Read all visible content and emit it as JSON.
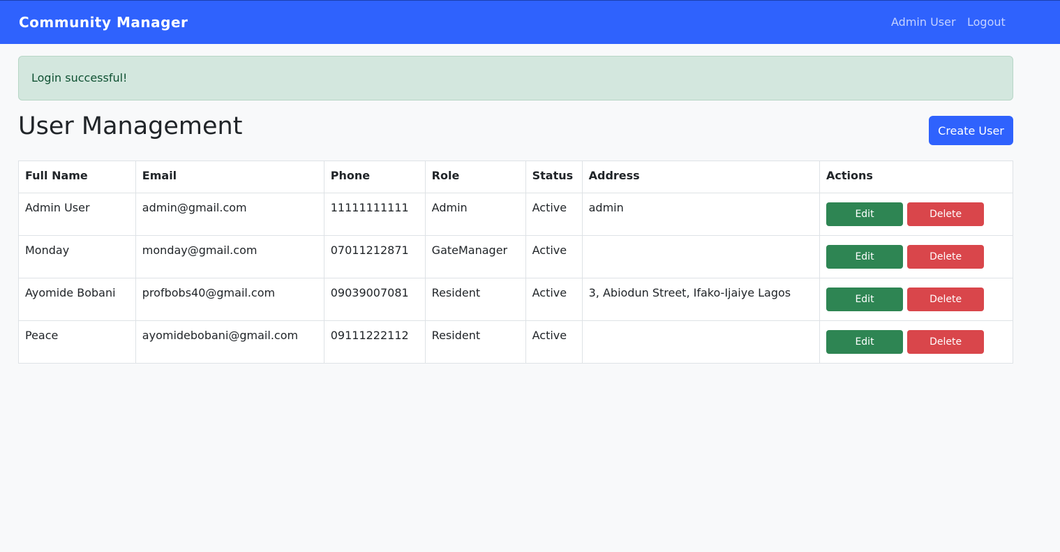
{
  "navbar": {
    "brand": "Community Manager",
    "user_link": "Admin User",
    "logout_link": "Logout"
  },
  "alert": {
    "message": "Login successful!"
  },
  "page": {
    "title": "User Management",
    "create_button": "Create User"
  },
  "table": {
    "headers": {
      "full_name": "Full Name",
      "email": "Email",
      "phone": "Phone",
      "role": "Role",
      "status": "Status",
      "address": "Address",
      "actions": "Actions"
    },
    "rows": [
      {
        "full_name": "Admin User",
        "email": "admin@gmail.com",
        "phone": "11111111111",
        "role": "Admin",
        "status": "Active",
        "address": "admin"
      },
      {
        "full_name": "Monday",
        "email": "monday@gmail.com",
        "phone": "07011212871",
        "role": "GateManager",
        "status": "Active",
        "address": ""
      },
      {
        "full_name": "Ayomide Bobani",
        "email": "profbobs40@gmail.com",
        "phone": "09039007081",
        "role": "Resident",
        "status": "Active",
        "address": "3, Abiodun Street, Ifako-Ijaiye Lagos"
      },
      {
        "full_name": "Peace",
        "email": "ayomidebobani@gmail.com",
        "phone": "09111222112",
        "role": "Resident",
        "status": "Active",
        "address": ""
      }
    ],
    "edit_label": "Edit",
    "delete_label": "Delete"
  },
  "colors": {
    "primary": "#2f62fd",
    "success": "#2e8553",
    "danger": "#d9464b",
    "alert_bg": "#d3e7de"
  }
}
